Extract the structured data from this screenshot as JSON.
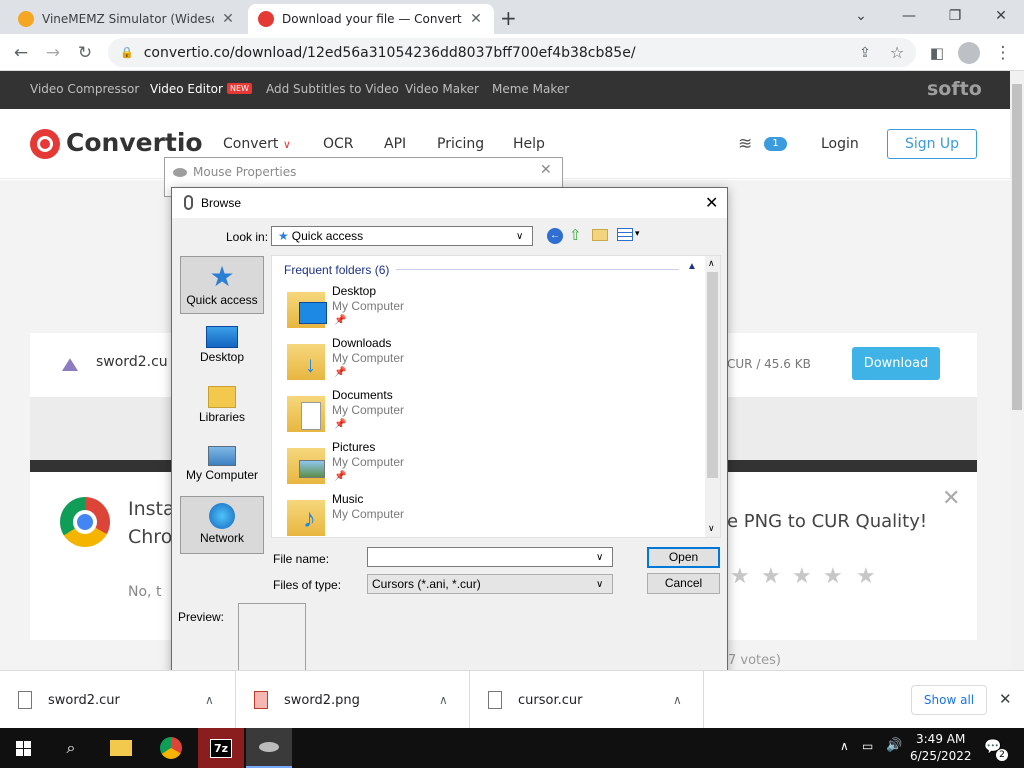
{
  "tabs": [
    {
      "title": "VineMEMZ Simulator (Widescre",
      "favicon_color": "#f5a623"
    },
    {
      "title": "Download your file — Convertio",
      "favicon_color": "#e53935"
    }
  ],
  "address_bar": {
    "url": "convertio.co/download/12ed56a31054236dd8037bff700ef4b38cb85e/"
  },
  "site_nav": {
    "items": [
      "Video Compressor",
      "Video Editor",
      "Add Subtitles to Video",
      "Video Maker",
      "Meme Maker"
    ],
    "new_badge": "NEW",
    "brand": "softo"
  },
  "header": {
    "logo": "Convertio",
    "nav": [
      "Convert",
      "OCR",
      "API",
      "Pricing",
      "Help"
    ],
    "layers_count": "1",
    "login": "Login",
    "signup": "Sign Up"
  },
  "page": {
    "file_name": "sword2.cu",
    "file_meta": "CUR / 45.6 KB",
    "download_label": "Download",
    "promo_left_1": "Insta",
    "promo_left_2": "Chro",
    "promo_no": "No, t",
    "promo_right": "e PNG to CUR Quality!",
    "votes": "7 votes)"
  },
  "mouse_props": {
    "title": "Mouse Properties"
  },
  "browse": {
    "title": "Browse",
    "look_in_label": "Look in:",
    "look_in_value": "Quick access",
    "places": [
      "Quick access",
      "Desktop",
      "Libraries",
      "My Computer",
      "Network"
    ],
    "group_header": "Frequent folders (6)",
    "folders": [
      {
        "name": "Desktop",
        "sub": "My Computer"
      },
      {
        "name": "Downloads",
        "sub": "My Computer"
      },
      {
        "name": "Documents",
        "sub": "My Computer"
      },
      {
        "name": "Pictures",
        "sub": "My Computer"
      },
      {
        "name": "Music",
        "sub": "My Computer"
      }
    ],
    "file_name_label": "File name:",
    "file_name_value": "",
    "files_of_type_label": "Files of type:",
    "files_of_type_value": "Cursors (*.ani, *.cur)",
    "open": "Open",
    "cancel": "Cancel",
    "preview_label": "Preview:"
  },
  "downloads": {
    "items": [
      "sword2.cur",
      "sword2.png",
      "cursor.cur"
    ],
    "show_all": "Show all"
  },
  "taskbar": {
    "time": "3:49 AM",
    "date": "6/25/2022",
    "notif_count": "2"
  },
  "colors": {
    "convertio_red": "#e53935",
    "download_blue": "#3fb3e6",
    "signup_blue": "#3b9bdc"
  }
}
